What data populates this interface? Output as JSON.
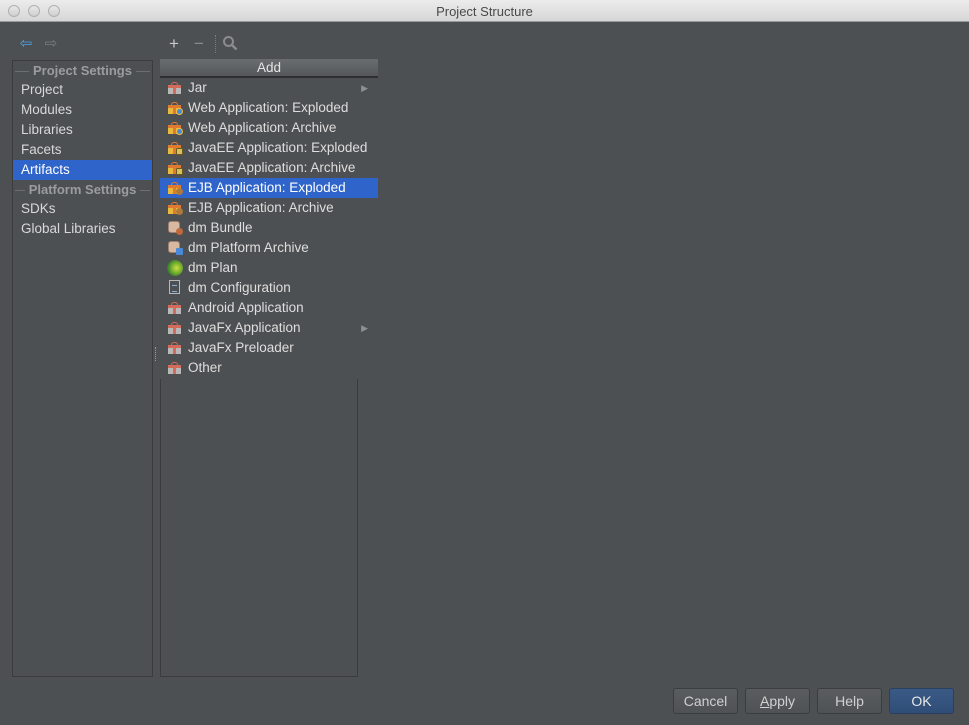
{
  "window": {
    "title": "Project Structure"
  },
  "toolbar": {
    "back_icon": "back-arrow-icon",
    "forward_icon": "forward-arrow-icon",
    "add_glyph": "+",
    "remove_glyph": "−",
    "find_icon": "search-icon"
  },
  "sidebar": {
    "groups": [
      {
        "header": "Project Settings",
        "items": [
          {
            "label": "Project"
          },
          {
            "label": "Modules"
          },
          {
            "label": "Libraries"
          },
          {
            "label": "Facets"
          },
          {
            "label": "Artifacts",
            "selected": true
          }
        ]
      },
      {
        "header": "Platform Settings",
        "items": [
          {
            "label": "SDKs"
          },
          {
            "label": "Global Libraries"
          }
        ]
      }
    ]
  },
  "add_popup": {
    "header": "Add",
    "items": [
      {
        "label": "Jar",
        "icon": "jar-gift-icon",
        "submenu": true
      },
      {
        "label": "Web Application: Exploded",
        "icon": "web-app-icon"
      },
      {
        "label": "Web Application: Archive",
        "icon": "web-app-icon"
      },
      {
        "label": "JavaEE Application: Exploded",
        "icon": "javaee-app-icon"
      },
      {
        "label": "JavaEE Application: Archive",
        "icon": "javaee-app-icon"
      },
      {
        "label": "EJB Application: Exploded",
        "icon": "ejb-app-icon",
        "selected": true
      },
      {
        "label": "EJB Application: Archive",
        "icon": "ejb-app-icon"
      },
      {
        "label": "dm Bundle",
        "icon": "dm-bundle-icon"
      },
      {
        "label": "dm Platform Archive",
        "icon": "dm-platform-icon"
      },
      {
        "label": "dm Plan",
        "icon": "dm-plan-icon"
      },
      {
        "label": "dm Configuration",
        "icon": "dm-config-icon"
      },
      {
        "label": "Android Application",
        "icon": "android-gift-icon"
      },
      {
        "label": "JavaFx Application",
        "icon": "javafx-gift-icon",
        "submenu": true
      },
      {
        "label": "JavaFx Preloader",
        "icon": "javafx-gift-icon"
      },
      {
        "label": "Other",
        "icon": "other-gift-icon"
      }
    ],
    "submenu_glyph": "▶"
  },
  "buttons": {
    "cancel": "Cancel",
    "apply_mnemonic": "A",
    "apply_rest": "pply",
    "help": "Help",
    "ok": "OK"
  },
  "colors": {
    "background": "#4d5052",
    "selection": "#2f65ca",
    "ok_button": "#33517c",
    "back_arrow": "#4aa3e6"
  }
}
